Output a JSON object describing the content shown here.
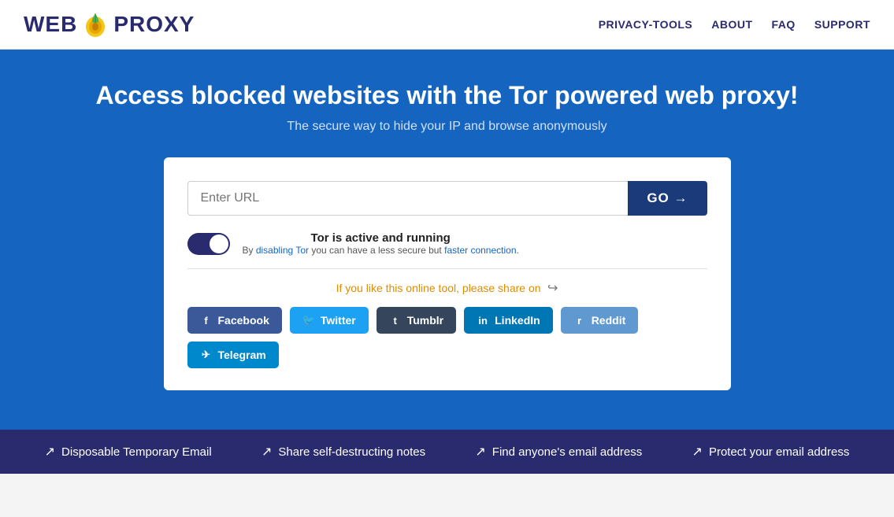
{
  "header": {
    "logo_web": "WEB",
    "logo_proxy": "PROXY",
    "nav": [
      {
        "label": "PRIVACY-TOOLS",
        "href": "#"
      },
      {
        "label": "ABOUT",
        "href": "#"
      },
      {
        "label": "FAQ",
        "href": "#"
      },
      {
        "label": "SUPPORT",
        "href": "#"
      }
    ]
  },
  "hero": {
    "heading": "Access blocked websites with the Tor powered web proxy!",
    "subheading": "The secure way to hide your IP and browse anonymously"
  },
  "card": {
    "input_placeholder": "Enter URL",
    "go_button": "GO →",
    "tor_title": "Tor is active and running",
    "tor_desc_prefix": "By ",
    "tor_desc_link": "disabling Tor",
    "tor_desc_middle": " you can have a less secure but faster connection.",
    "share_text": "If you like this online tool, please share on",
    "social": [
      {
        "label": "Facebook",
        "class": "facebook",
        "icon": "f"
      },
      {
        "label": "Twitter",
        "class": "twitter",
        "icon": "🐦"
      },
      {
        "label": "Tumblr",
        "class": "tumblr",
        "icon": "t"
      },
      {
        "label": "LinkedIn",
        "class": "linkedin",
        "icon": "in"
      },
      {
        "label": "Reddit",
        "class": "reddit",
        "icon": "r"
      },
      {
        "label": "Telegram",
        "class": "telegram",
        "icon": "✈"
      }
    ]
  },
  "footer": {
    "links": [
      {
        "label": "Disposable Temporary Email"
      },
      {
        "label": "Share self-destructing notes"
      },
      {
        "label": "Find anyone's email address"
      },
      {
        "label": "Protect your email address"
      }
    ]
  }
}
